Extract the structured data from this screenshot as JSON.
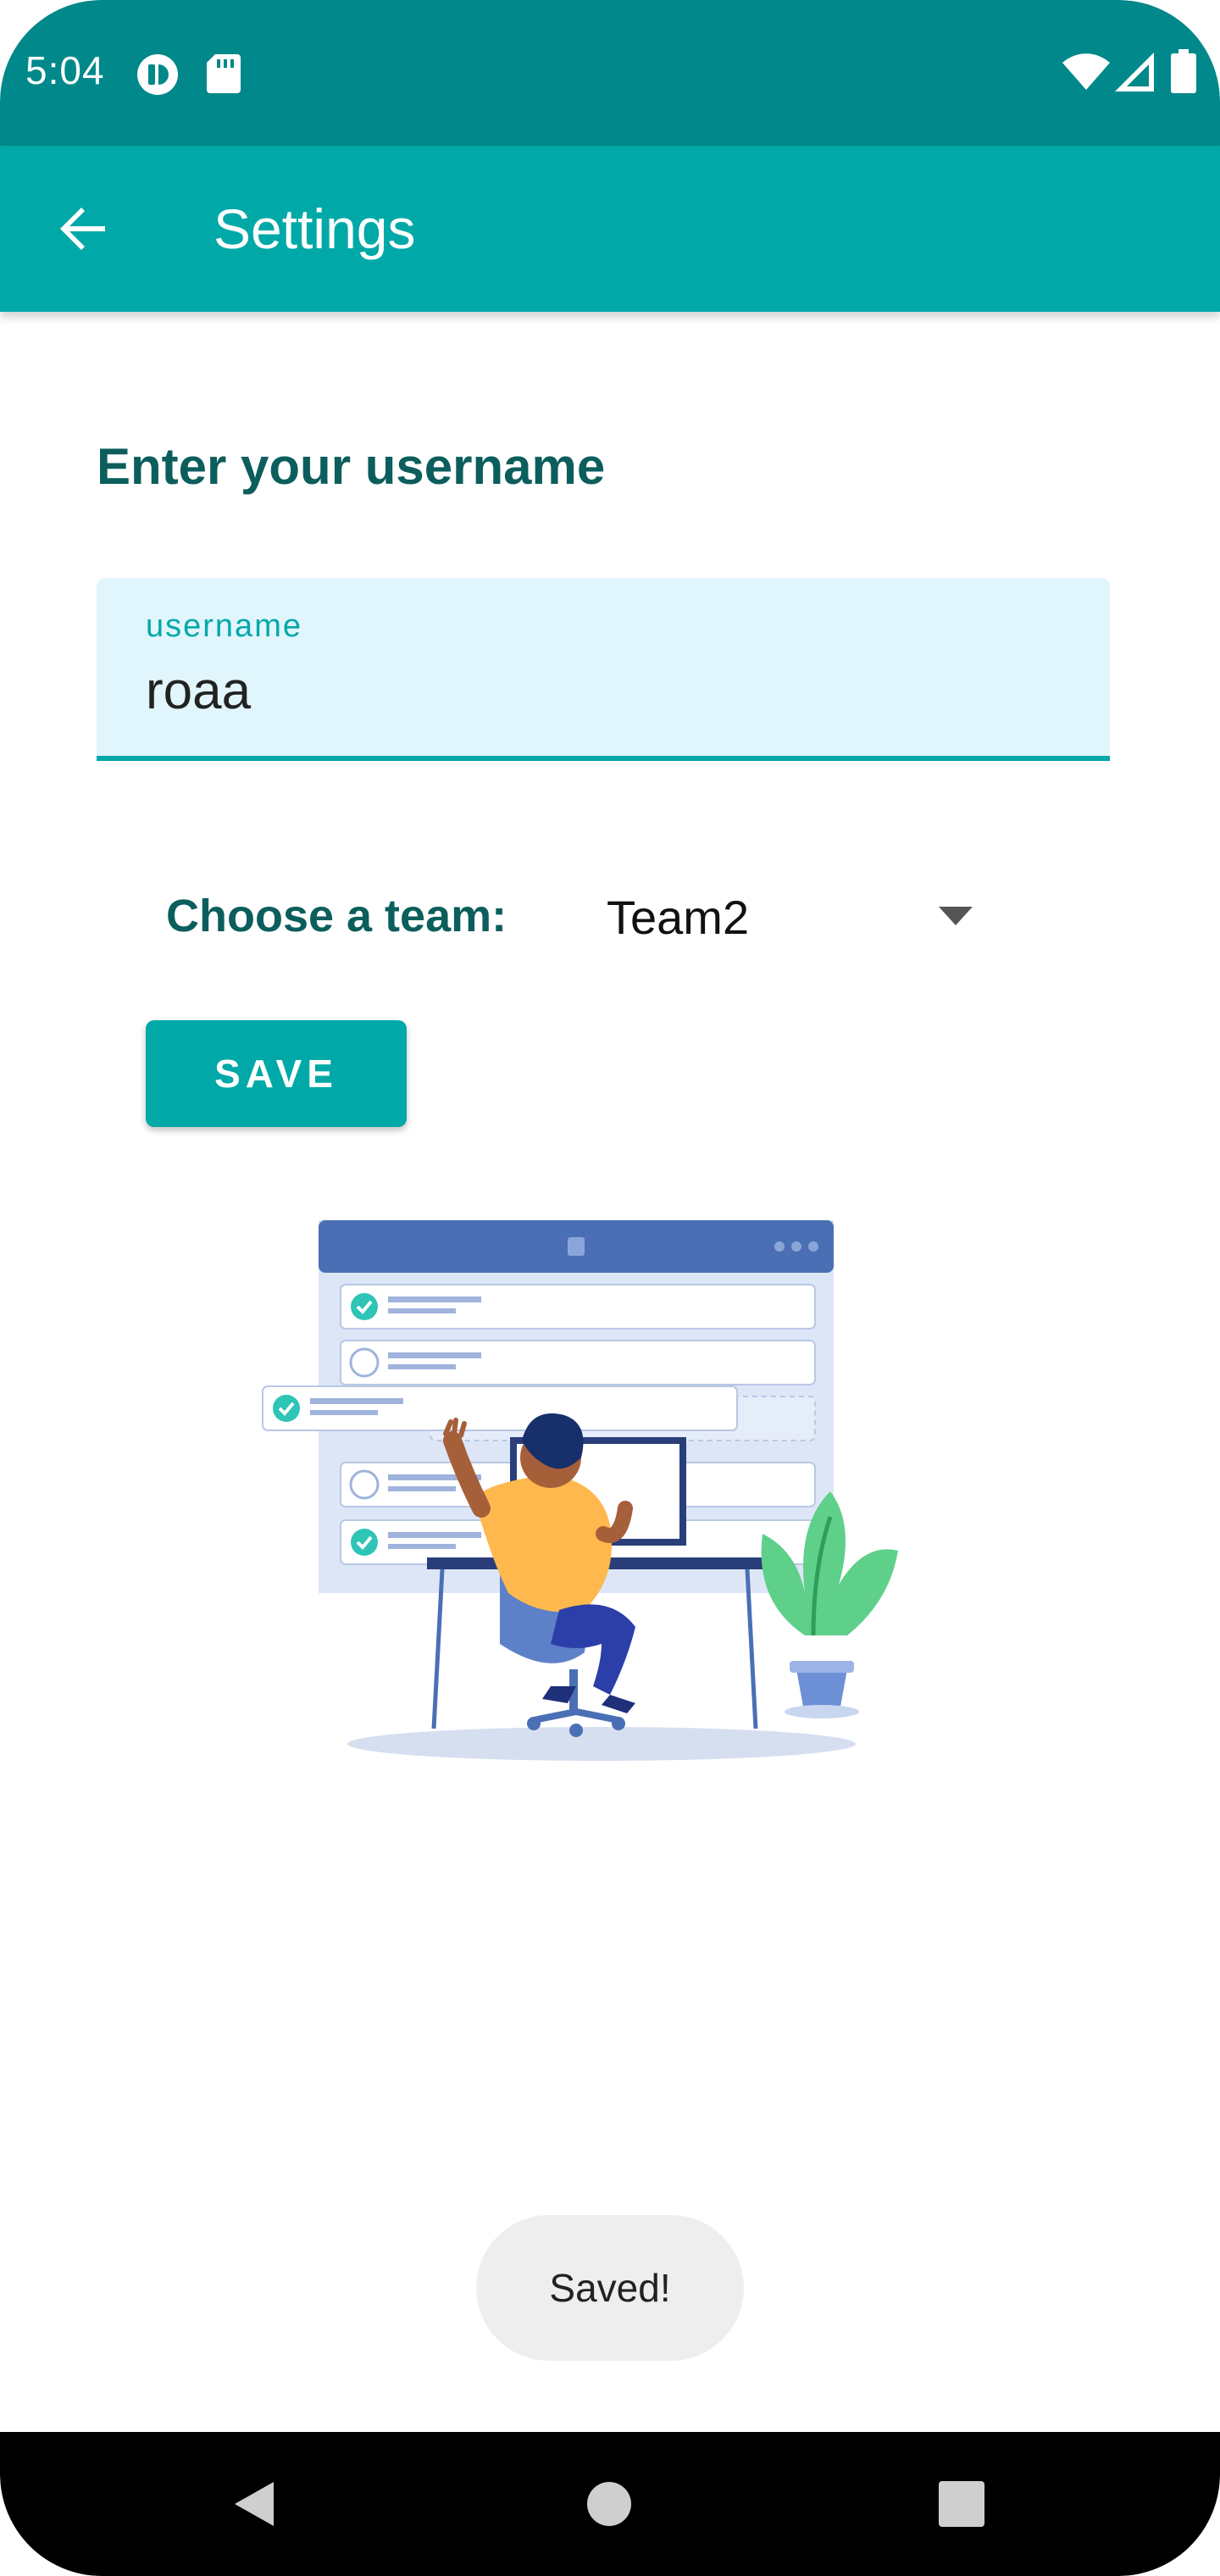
{
  "status_bar": {
    "time": "5:04",
    "icons": [
      "media-icon",
      "sd-card-icon",
      "wifi-icon",
      "signal-icon",
      "battery-icon"
    ]
  },
  "app_bar": {
    "title": "Settings",
    "back_icon": "arrow-back-icon"
  },
  "form": {
    "heading": "Enter your username",
    "username": {
      "label": "username",
      "value": "roaa"
    },
    "team": {
      "label": "Choose a team:",
      "selected": "Team2"
    },
    "save_label": "SAVE"
  },
  "illustration": {
    "name": "person-at-desk-task-list-illustration"
  },
  "toast": {
    "message": "Saved!"
  },
  "nav_bar": {
    "buttons": [
      "back-triangle-icon",
      "home-circle-icon",
      "recents-square-icon"
    ]
  },
  "colors": {
    "status_bar": "#00888a",
    "app_bar": "#00a9a8",
    "accent": "#00a9a8",
    "heading_text": "#0b5e5c",
    "input_bg": "#e1f5fd",
    "toast_bg": "#eeeeee"
  }
}
